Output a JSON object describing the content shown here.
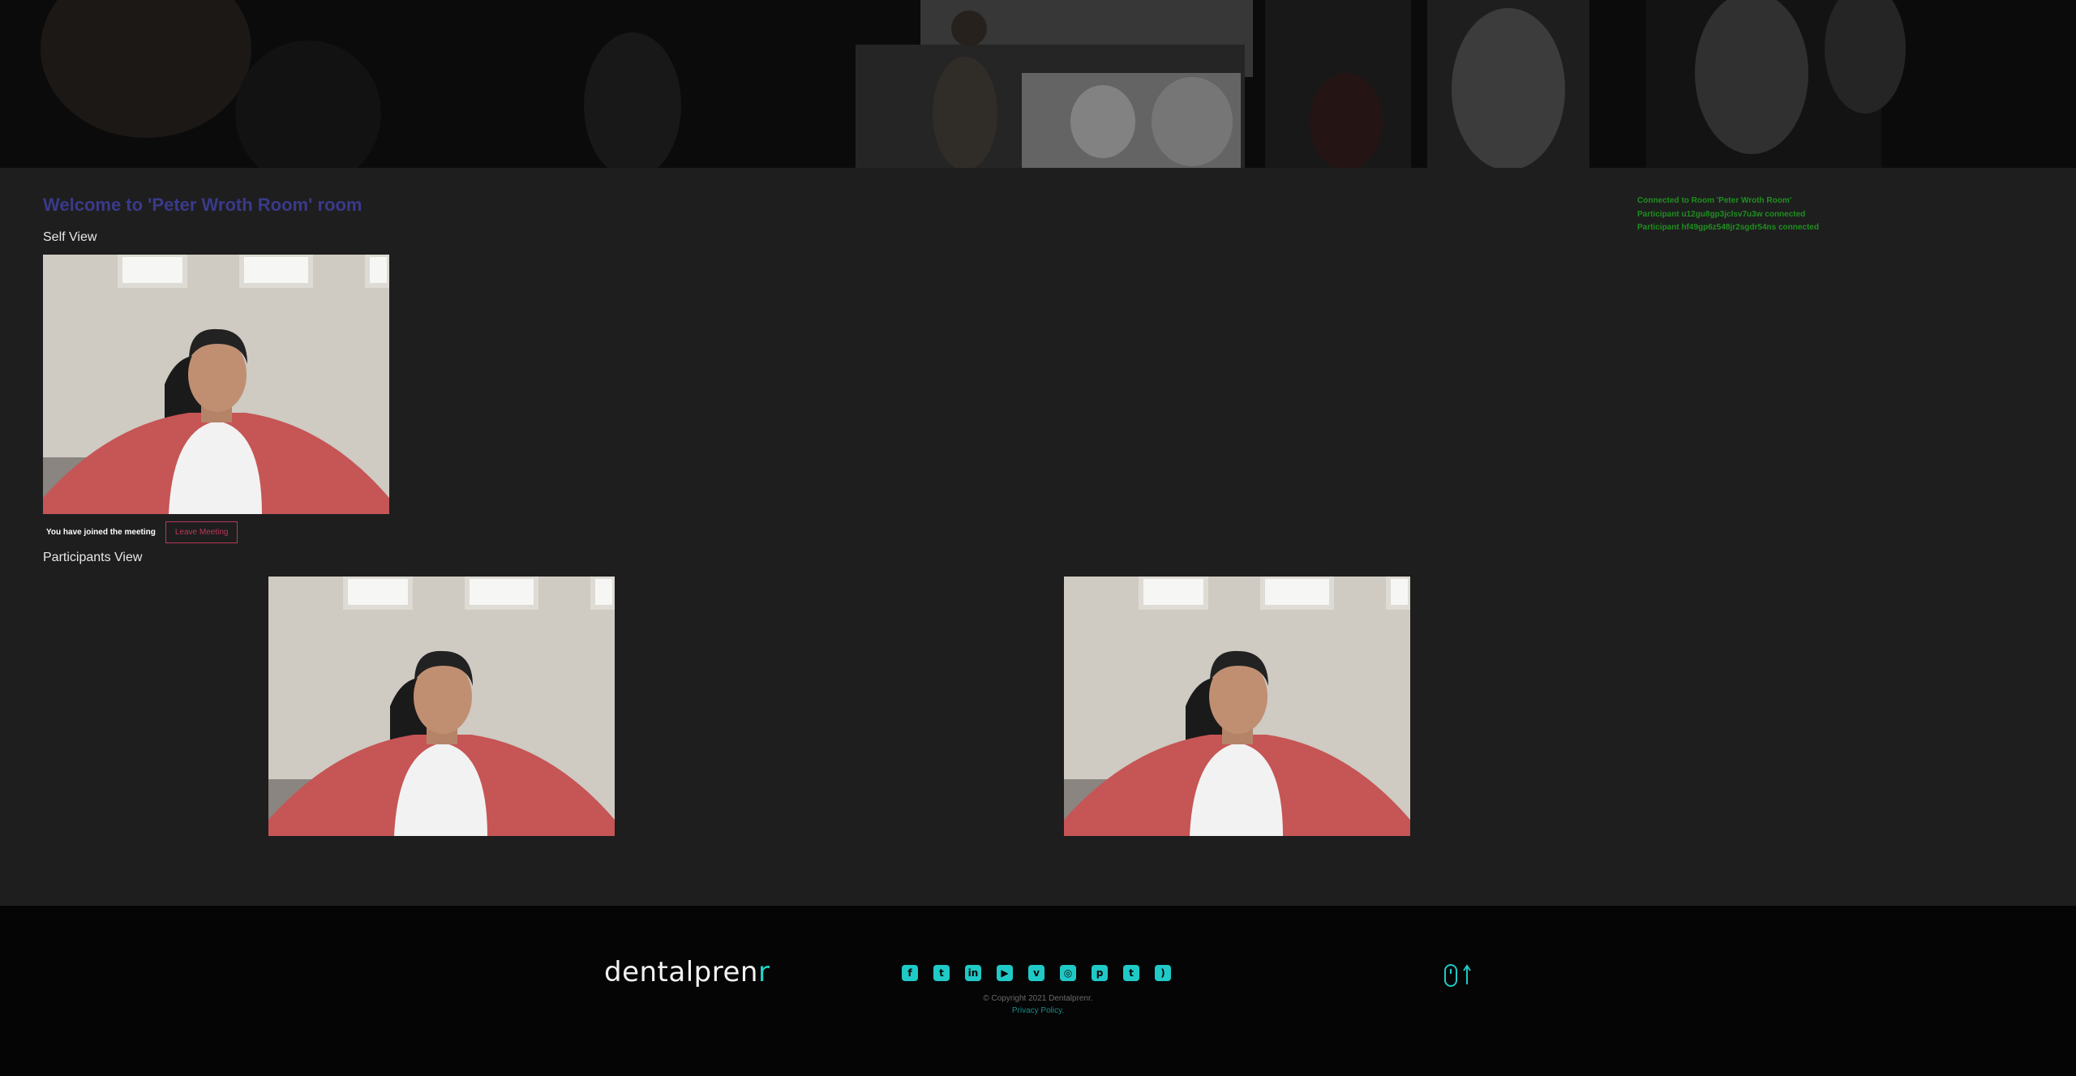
{
  "room": {
    "title": "Welcome to 'Peter Wroth Room' room",
    "self_view_label": "Self View",
    "joined_text": "You have joined the meeting",
    "leave_label": "Leave Meeting",
    "participants_label": "Participants View"
  },
  "log": [
    "Connected to Room 'Peter Wroth Room'",
    "Participant u12gu8gp3jclsv7u3w connected",
    "Participant hf49gp6z548jr2sgdr54ns connected"
  ],
  "footer": {
    "logo_main": "dent",
    "logo_mid": "alpren",
    "logo_accent": "r",
    "social": [
      {
        "icon": "facebook-icon",
        "glyph": "f"
      },
      {
        "icon": "twitter-icon",
        "glyph": "t"
      },
      {
        "icon": "linkedin-icon",
        "glyph": "in"
      },
      {
        "icon": "youtube-icon",
        "glyph": "▶"
      },
      {
        "icon": "vimeo-icon",
        "glyph": "v"
      },
      {
        "icon": "instagram-icon",
        "glyph": "◎"
      },
      {
        "icon": "pinterest-icon",
        "glyph": "p"
      },
      {
        "icon": "tumblr-icon",
        "glyph": "t"
      },
      {
        "icon": "rss-icon",
        "glyph": ")"
      }
    ],
    "copyright": "© Copyright 2021 Dentalprenr.",
    "privacy": "Privacy Policy."
  },
  "colors": {
    "accent": "#1fc9c6",
    "title": "#3a3a8a",
    "log_text": "#1f8f1f",
    "leave_button": "#b83a57"
  }
}
